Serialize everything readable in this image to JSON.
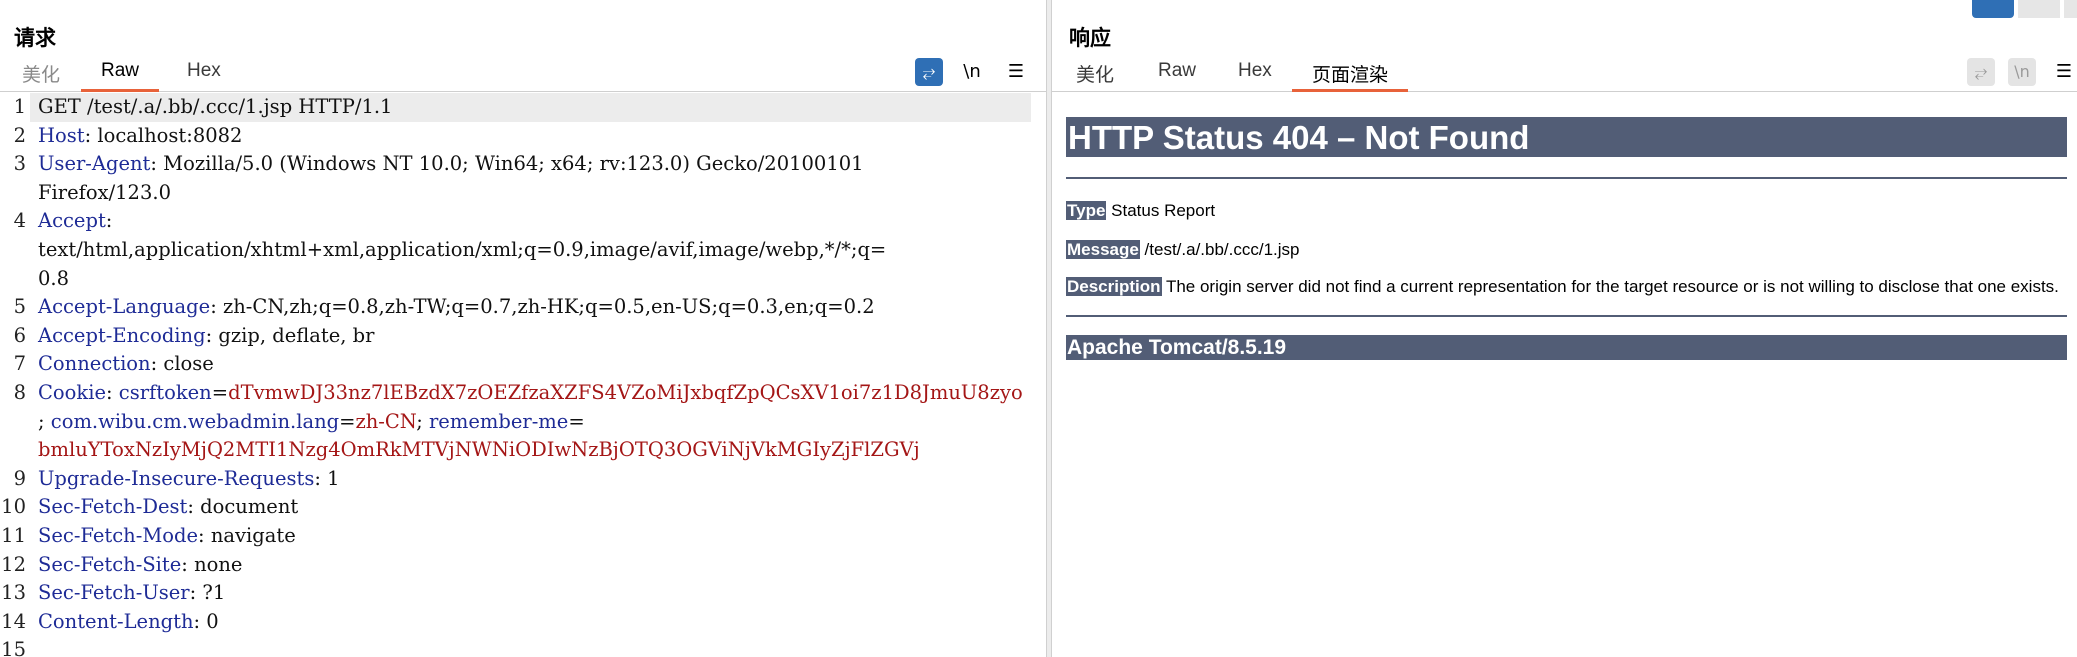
{
  "request": {
    "title": "请求",
    "tabs": [
      "美化",
      "Raw",
      "Hex"
    ],
    "active_tab": "Raw",
    "tools": {
      "wrap": "⥂",
      "newline": "\\n",
      "menu": "☰"
    },
    "lines": [
      {
        "n": "1",
        "parts": [
          {
            "t": "GET /test/.a/.bb/.ccc/1.jsp HTTP/1.1",
            "c": "plain"
          }
        ]
      },
      {
        "n": "2",
        "parts": [
          {
            "t": "Host",
            "c": "k"
          },
          {
            "t": ": localhost:8082",
            "c": "plain"
          }
        ]
      },
      {
        "n": "3",
        "parts": [
          {
            "t": "User-Agent",
            "c": "k"
          },
          {
            "t": ": Mozilla/5.0 (Windows NT 10.0; Win64; x64; rv:123.0) Gecko/20100101",
            "c": "plain"
          }
        ]
      },
      {
        "n": "",
        "parts": [
          {
            "t": "Firefox/123.0",
            "c": "plain"
          }
        ]
      },
      {
        "n": "4",
        "parts": [
          {
            "t": "Accept",
            "c": "k"
          },
          {
            "t": ":",
            "c": "plain"
          }
        ]
      },
      {
        "n": "",
        "parts": [
          {
            "t": "text/html,application/xhtml+xml,application/xml;q=0.9,image/avif,image/webp,*/*;q=",
            "c": "plain"
          }
        ]
      },
      {
        "n": "",
        "parts": [
          {
            "t": "0.8",
            "c": "plain"
          }
        ]
      },
      {
        "n": "5",
        "parts": [
          {
            "t": "Accept-Language",
            "c": "k"
          },
          {
            "t": ": zh-CN,zh;q=0.8,zh-TW;q=0.7,zh-HK;q=0.5,en-US;q=0.3,en;q=0.2",
            "c": "plain"
          }
        ]
      },
      {
        "n": "6",
        "parts": [
          {
            "t": "Accept-Encoding",
            "c": "k"
          },
          {
            "t": ": gzip, deflate, br",
            "c": "plain"
          }
        ]
      },
      {
        "n": "7",
        "parts": [
          {
            "t": "Connection",
            "c": "k"
          },
          {
            "t": ": close",
            "c": "plain"
          }
        ]
      },
      {
        "n": "8",
        "parts": [
          {
            "t": "Cookie",
            "c": "k"
          },
          {
            "t": ": ",
            "c": "plain"
          },
          {
            "t": "csrftoken",
            "c": "k"
          },
          {
            "t": "=",
            "c": "plain"
          },
          {
            "t": "dTvmwDJ33nz7lEBzdX7zOEZfzaXZFS4VZoMiJxbqfZpQCsXV1oi7z1D8JmuU8zyo",
            "c": "v"
          }
        ]
      },
      {
        "n": "",
        "parts": [
          {
            "t": "; ",
            "c": "plain"
          },
          {
            "t": "com.wibu.cm.webadmin.lang",
            "c": "k"
          },
          {
            "t": "=",
            "c": "plain"
          },
          {
            "t": "zh-CN",
            "c": "v"
          },
          {
            "t": "; ",
            "c": "plain"
          },
          {
            "t": "remember-me",
            "c": "k"
          },
          {
            "t": "=",
            "c": "plain"
          }
        ]
      },
      {
        "n": "",
        "parts": [
          {
            "t": "bmluYToxNzIyMjQ2MTI1Nzg4OmRkMTVjNWNiODIwNzBjOTQ3OGViNjVkMGIyZjFlZGVj",
            "c": "v"
          }
        ]
      },
      {
        "n": "9",
        "parts": [
          {
            "t": "Upgrade-Insecure-Requests",
            "c": "k"
          },
          {
            "t": ": 1",
            "c": "plain"
          }
        ]
      },
      {
        "n": "10",
        "parts": [
          {
            "t": "Sec-Fetch-Dest",
            "c": "k"
          },
          {
            "t": ": document",
            "c": "plain"
          }
        ]
      },
      {
        "n": "11",
        "parts": [
          {
            "t": "Sec-Fetch-Mode",
            "c": "k"
          },
          {
            "t": ": navigate",
            "c": "plain"
          }
        ]
      },
      {
        "n": "12",
        "parts": [
          {
            "t": "Sec-Fetch-Site",
            "c": "k"
          },
          {
            "t": ": none",
            "c": "plain"
          }
        ]
      },
      {
        "n": "13",
        "parts": [
          {
            "t": "Sec-Fetch-User",
            "c": "k"
          },
          {
            "t": ": ?1",
            "c": "plain"
          }
        ]
      },
      {
        "n": "14",
        "parts": [
          {
            "t": "Content-Length",
            "c": "k"
          },
          {
            "t": ": 0",
            "c": "plain"
          }
        ]
      },
      {
        "n": "15",
        "parts": [
          {
            "t": "",
            "c": "plain"
          }
        ]
      }
    ]
  },
  "response": {
    "title": "响应",
    "tabs": [
      "美化",
      "Raw",
      "Hex",
      "页面渲染"
    ],
    "active_tab": "页面渲染",
    "tools": {
      "wrap": "⥂",
      "newline": "\\n",
      "menu": "☰"
    },
    "page": {
      "heading": "HTTP Status 404 – Not Found",
      "type_label": "Type",
      "type_value": " Status Report",
      "message_label": "Message",
      "message_value": " /test/.a/.bb/.ccc/1.jsp",
      "description_label": "Description",
      "description_value": " The origin server did not find a current representation for the target resource or is not willing to disclose that one exists.",
      "footer": "Apache Tomcat/8.5.19"
    }
  },
  "colors": {
    "accent_tab_underline": "#e8623a",
    "header_key": "#1e2b96",
    "value_red": "#a41616",
    "tomcat_banner": "#525d76",
    "wrap_button": "#2f6fb5"
  }
}
